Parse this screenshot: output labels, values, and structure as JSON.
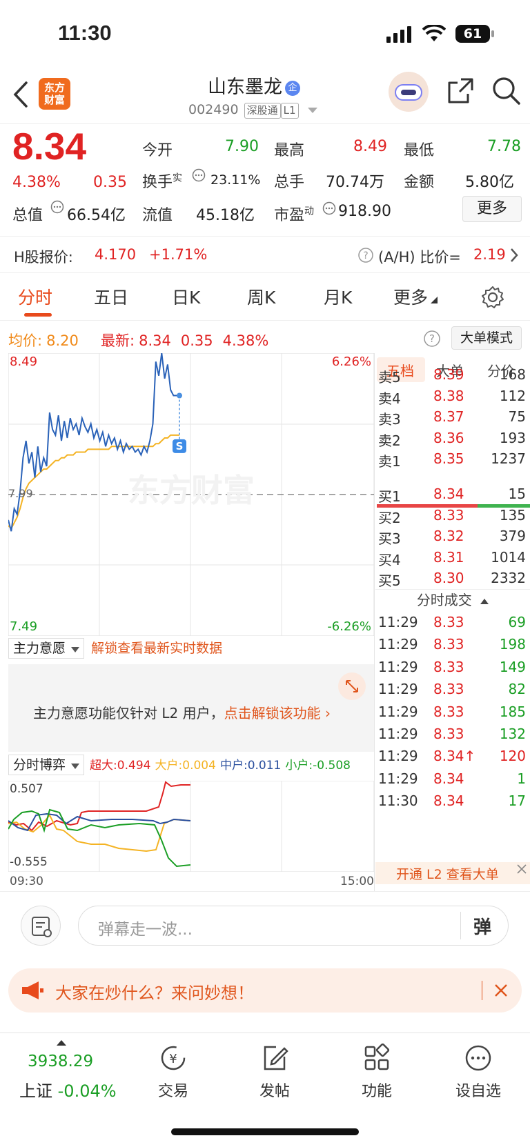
{
  "status_bar": {
    "time": "11:30",
    "battery": "61"
  },
  "header": {
    "logo_text_1": "东方",
    "logo_text_2": "财富",
    "stock_name": "山东墨龙",
    "badge": "企",
    "code": "002490",
    "tag_market": "深股通",
    "tag_level": "L1"
  },
  "quote": {
    "price": "8.34",
    "change_pct": "4.38%",
    "change": "0.35",
    "open_label": "今开",
    "open": "7.90",
    "high_label": "最高",
    "high": "8.49",
    "low_label": "最低",
    "low": "7.78",
    "turnover_label": "换手",
    "turnover_sup": "实",
    "turnover": "23.11%",
    "volume_label": "总手",
    "volume": "70.74万",
    "amount_label": "金额",
    "amount": "5.80亿",
    "mktcap_label": "总值",
    "mktcap": "66.54亿",
    "float_label": "流值",
    "float": "45.18亿",
    "pe_label": "市盈",
    "pe_sup": "动",
    "pe": "918.90",
    "more": "更多"
  },
  "h_share": {
    "label": "H股报价:",
    "price": "4.170",
    "change": "+1.71%",
    "ratio_label": "(A/H) 比价=",
    "ratio": "2.19"
  },
  "tabs": [
    "分时",
    "五日",
    "日K",
    "周K",
    "月K",
    "更多"
  ],
  "price_bar": {
    "avg_label": "均价:",
    "avg": "8.20",
    "latest_label": "最新:",
    "latest": "8.34",
    "chg": "0.35",
    "pct": "4.38%",
    "big_mode": "大单模式"
  },
  "chart_data": {
    "type": "line",
    "x_start": "09:30",
    "x_end": "15:00",
    "ylim": [
      7.49,
      8.49
    ],
    "y_top_label": "8.49",
    "y_bottom_label": "7.49",
    "y_mid_label": "7.99",
    "pct_top": "6.26%",
    "pct_bottom": "-6.26%",
    "watermark": "东方财富",
    "marker": "S",
    "series": [
      {
        "role": "price",
        "values": [
          7.9,
          7.86,
          7.94,
          7.92,
          8.0,
          8.12,
          8.18,
          8.1,
          8.14,
          8.05,
          8.16,
          8.07,
          8.12,
          8.09,
          8.28,
          8.22,
          8.2,
          8.27,
          8.18,
          8.25,
          8.19,
          8.26,
          8.22,
          8.24,
          8.2,
          8.26,
          8.23,
          8.21,
          8.24,
          8.19,
          8.22,
          8.18,
          8.21,
          8.16,
          8.2,
          8.17,
          8.19,
          8.15,
          8.18,
          8.14,
          8.17,
          8.15,
          8.16,
          8.14,
          8.15,
          8.13,
          8.16,
          8.14,
          8.18,
          8.24,
          8.46,
          8.41,
          8.49,
          8.4,
          8.45,
          8.36,
          8.34,
          8.34,
          8.34
        ]
      },
      {
        "role": "avg",
        "values": [
          7.88,
          7.87,
          7.89,
          7.91,
          7.94,
          7.98,
          8.01,
          8.03,
          8.04,
          8.05,
          8.06,
          8.07,
          8.08,
          8.08,
          8.09,
          8.1,
          8.11,
          8.11,
          8.12,
          8.12,
          8.13,
          8.13,
          8.13,
          8.14,
          8.14,
          8.14,
          8.14,
          8.15,
          8.15,
          8.15,
          8.15,
          8.15,
          8.15,
          8.15,
          8.15,
          8.16,
          8.16,
          8.16,
          8.16,
          8.16,
          8.16,
          8.16,
          8.16,
          8.16,
          8.16,
          8.16,
          8.16,
          8.16,
          8.16,
          8.16,
          8.17,
          8.17,
          8.18,
          8.19,
          8.19,
          8.2,
          8.2,
          8.2,
          8.2
        ]
      }
    ]
  },
  "order_book": {
    "tabs": [
      "五档",
      "大单",
      "分价"
    ],
    "asks": [
      {
        "label": "卖5",
        "price": "8.39",
        "vol": "168"
      },
      {
        "label": "卖4",
        "price": "8.38",
        "vol": "112"
      },
      {
        "label": "卖3",
        "price": "8.37",
        "vol": "75"
      },
      {
        "label": "卖2",
        "price": "8.36",
        "vol": "193"
      },
      {
        "label": "卖1",
        "price": "8.35",
        "vol": "1237"
      }
    ],
    "bids": [
      {
        "label": "买1",
        "price": "8.34",
        "vol": "15"
      },
      {
        "label": "买2",
        "price": "8.33",
        "vol": "135"
      },
      {
        "label": "买3",
        "price": "8.32",
        "vol": "379"
      },
      {
        "label": "买4",
        "price": "8.31",
        "vol": "1014"
      },
      {
        "label": "买5",
        "price": "8.30",
        "vol": "2332"
      }
    ],
    "ticks_title": "分时成交",
    "ticks": [
      {
        "time": "11:29",
        "price": "8.33",
        "vol": "69",
        "dir": "sell"
      },
      {
        "time": "11:29",
        "price": "8.33",
        "vol": "198",
        "dir": "sell"
      },
      {
        "time": "11:29",
        "price": "8.33",
        "vol": "149",
        "dir": "sell"
      },
      {
        "time": "11:29",
        "price": "8.33",
        "vol": "82",
        "dir": "sell"
      },
      {
        "time": "11:29",
        "price": "8.33",
        "vol": "185",
        "dir": "sell"
      },
      {
        "time": "11:29",
        "price": "8.33",
        "vol": "132",
        "dir": "sell"
      },
      {
        "time": "11:29",
        "price": "8.34↑",
        "vol": "120",
        "dir": "buy"
      },
      {
        "time": "11:29",
        "price": "8.34",
        "vol": "1",
        "dir": "sell"
      },
      {
        "time": "11:30",
        "price": "8.34",
        "vol": "17",
        "dir": "sell"
      }
    ],
    "l2_banner": "开通 L2 查看大单"
  },
  "main_force": {
    "dropdown": "主力意愿",
    "unlock_hint": "解锁查看最新实时数据",
    "body_text": "主力意愿功能仅针对 L2 用户，",
    "body_link": "点击解锁该功能"
  },
  "game": {
    "dropdown": "分时博弈",
    "super_label": "超大:",
    "super": "0.494",
    "big_label": "大户:",
    "big": "0.004",
    "mid_label": "中户:",
    "mid": "0.011",
    "small_label": "小户:",
    "small": "-0.508",
    "ymax": "0.507",
    "ymin": "-0.555",
    "x_start": "09:30",
    "x_end": "15:00"
  },
  "danmu": {
    "placeholder": "弹幕走一波...",
    "btn": "弹"
  },
  "ask_banner": {
    "text": "大家在炒什么？来问妙想！"
  },
  "bottom_nav": {
    "index_value": "3938.29",
    "index_name": "上证",
    "index_change": "-0.04%",
    "trade": "交易",
    "post": "发帖",
    "func": "功能",
    "watch": "设自选"
  },
  "colors": {
    "up": "#e02323",
    "down": "#1a9e24",
    "accent": "#e84a1c",
    "price_line": "#2a62b8",
    "avg_line": "#f4b323"
  }
}
